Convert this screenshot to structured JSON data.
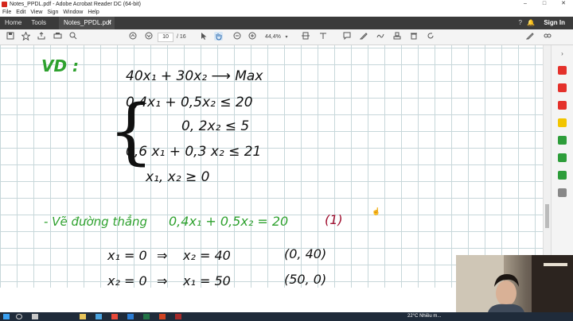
{
  "window": {
    "title": "Notes_PPDL.pdf - Adobe Acrobat Reader DC (64-bit)",
    "controls": [
      "–",
      "□",
      "✕"
    ]
  },
  "menu": [
    "File",
    "Edit",
    "View",
    "Sign",
    "Window",
    "Help"
  ],
  "tabs": {
    "home": "Home",
    "tools": "Tools",
    "document": "Notes_PPDL.pdf",
    "close": "×",
    "help": "?",
    "bell": "🔔",
    "signin": "Sign In"
  },
  "toolbar": {
    "page_current": "10",
    "page_total": "/ 16",
    "zoom": "44,4%"
  },
  "notes": {
    "vd": "VD :",
    "objective": "40x₁ + 30x₂ ⟶ Max",
    "c1": "0,4x₁ + 0,5x₂ ≤ 20",
    "c2": "0, 2x₂ ≤ 5",
    "c3": "0,6 x₁ + 0,3 x₂ ≤ 21",
    "c4": "x₁, x₂ ≥ 0",
    "line_title": "- Vẽ đường thẳng",
    "line_eq": "0,4x₁ + 0,5x₂ = 20",
    "line_num": "(1)",
    "r1_left": "x₁ = 0",
    "r1_arrow": "⇒",
    "r1_right": "x₂ = 40",
    "r1_point": "(0, 40)",
    "r2_left": "x₂ = 0",
    "r2_arrow": "⇒",
    "r2_right": "x₁ = 50",
    "r2_point": "(50, 0)"
  },
  "taskbar": {
    "weather": "22°C  Nhiều m..."
  },
  "colors": {
    "ink_green": "#2ea12e",
    "ink_red": "#a01030",
    "grid": "#c7d7da",
    "tabbar_bg": "#3b3b3b"
  }
}
